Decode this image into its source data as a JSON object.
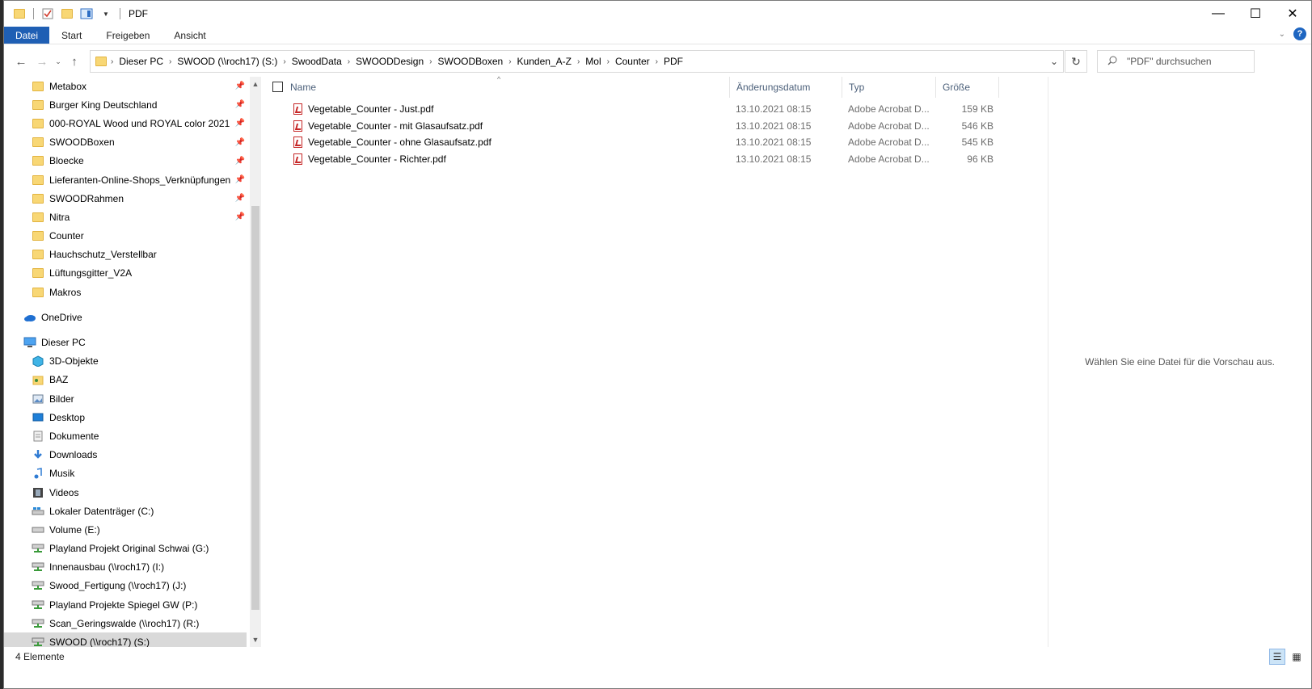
{
  "window": {
    "title": "PDF",
    "controls": {
      "minimize": "—",
      "maximize": "☐",
      "close": "✕"
    }
  },
  "ribbon": {
    "tabs": [
      "Datei",
      "Start",
      "Freigeben",
      "Ansicht"
    ],
    "help": "?"
  },
  "address": {
    "crumbs": [
      "Dieser PC",
      "SWOOD (\\\\roch17) (S:)",
      "SwoodData",
      "SWOODDesign",
      "SWOODBoxen",
      "Kunden_A-Z",
      "Mol",
      "Counter",
      "PDF"
    ],
    "search_placeholder": "\"PDF\" durchsuchen"
  },
  "nav": {
    "quick_access": [
      {
        "label": "Metabox",
        "pinned": true
      },
      {
        "label": "Burger King Deutschland",
        "pinned": true
      },
      {
        "label": "000-ROYAL Wood und ROYAL color 2021",
        "pinned": true
      },
      {
        "label": "SWOODBoxen",
        "pinned": true
      },
      {
        "label": "Bloecke",
        "pinned": true
      },
      {
        "label": "Lieferanten-Online-Shops_Verknüpfungen",
        "pinned": true
      },
      {
        "label": "SWOODRahmen",
        "pinned": true
      },
      {
        "label": "Nitra",
        "pinned": true
      },
      {
        "label": "Counter",
        "pinned": false
      },
      {
        "label": "Hauchschutz_Verstellbar",
        "pinned": false
      },
      {
        "label": "Lüftungsgitter_V2A",
        "pinned": false
      },
      {
        "label": "Makros",
        "pinned": false
      }
    ],
    "onedrive": "OneDrive",
    "this_pc": "Dieser PC",
    "pc_items": [
      {
        "label": "3D-Objekte",
        "icon": "cube-icon"
      },
      {
        "label": "BAZ",
        "icon": "shared-folder-icon"
      },
      {
        "label": "Bilder",
        "icon": "pictures-icon"
      },
      {
        "label": "Desktop",
        "icon": "desktop-icon"
      },
      {
        "label": "Dokumente",
        "icon": "documents-icon"
      },
      {
        "label": "Downloads",
        "icon": "download-icon"
      },
      {
        "label": "Musik",
        "icon": "music-icon"
      },
      {
        "label": "Videos",
        "icon": "videos-icon"
      },
      {
        "label": "Lokaler Datenträger (C:)",
        "icon": "local-disk-icon"
      },
      {
        "label": "Volume (E:)",
        "icon": "drive-icon"
      },
      {
        "label": "Playland Projekt Original Schwai (G:)",
        "icon": "network-drive-icon"
      },
      {
        "label": "Innenausbau (\\\\roch17) (I:)",
        "icon": "network-drive-icon"
      },
      {
        "label": "Swood_Fertigung (\\\\roch17) (J:)",
        "icon": "network-drive-icon"
      },
      {
        "label": "Playland Projekte Spiegel GW (P:)",
        "icon": "network-drive-icon"
      },
      {
        "label": "Scan_Geringswalde (\\\\roch17) (R:)",
        "icon": "network-drive-icon"
      },
      {
        "label": "SWOOD (\\\\roch17) (S:)",
        "icon": "network-drive-icon",
        "selected": true
      }
    ]
  },
  "columns": {
    "name": "Name",
    "date": "Änderungsdatum",
    "type": "Typ",
    "size": "Größe"
  },
  "files": [
    {
      "name": "Vegetable_Counter - Just.pdf",
      "date": "13.10.2021 08:15",
      "type": "Adobe Acrobat D...",
      "size": "159 KB"
    },
    {
      "name": "Vegetable_Counter - mit Glasaufsatz.pdf",
      "date": "13.10.2021 08:15",
      "type": "Adobe Acrobat D...",
      "size": "546 KB"
    },
    {
      "name": "Vegetable_Counter - ohne Glasaufsatz.pdf",
      "date": "13.10.2021 08:15",
      "type": "Adobe Acrobat D...",
      "size": "545 KB"
    },
    {
      "name": "Vegetable_Counter - Richter.pdf",
      "date": "13.10.2021 08:15",
      "type": "Adobe Acrobat D...",
      "size": "96 KB"
    }
  ],
  "preview": {
    "message": "Wählen Sie eine Datei für die Vorschau aus."
  },
  "status": {
    "count": "4 Elemente"
  },
  "colors": {
    "accent": "#1f5fb4",
    "folder": "#f8d775",
    "pdf": "#c62828"
  }
}
